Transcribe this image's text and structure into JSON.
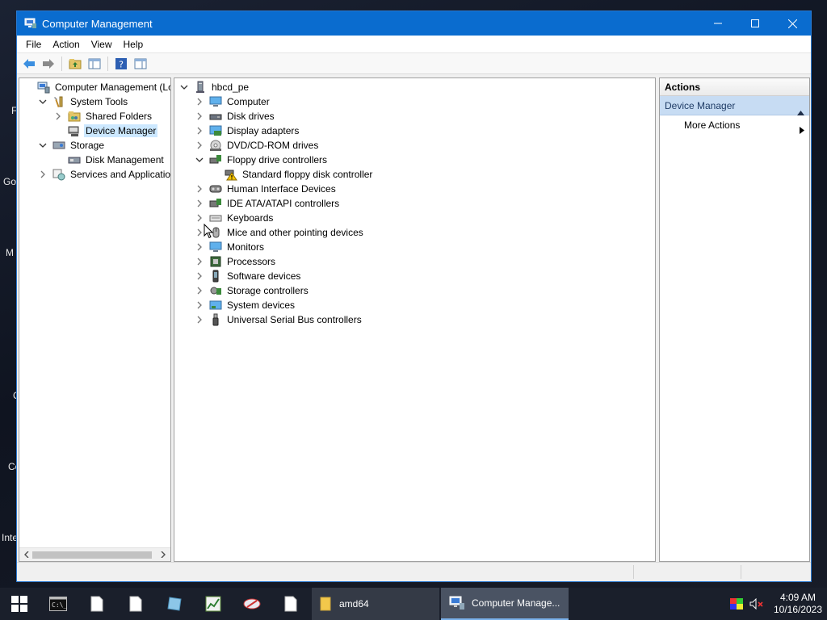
{
  "window": {
    "title": "Computer Management",
    "menus": [
      "File",
      "Action",
      "View",
      "Help"
    ]
  },
  "left_tree": [
    {
      "label": "Computer Management (Local",
      "icon": "computer-management-icon",
      "expand": "none",
      "level": 0
    },
    {
      "label": "System Tools",
      "icon": "tools-icon",
      "expand": "open",
      "level": 1
    },
    {
      "label": "Shared Folders",
      "icon": "shared-folder-icon",
      "expand": "closed",
      "level": 2
    },
    {
      "label": "Device Manager",
      "icon": "device-manager-icon",
      "expand": "none",
      "level": 2,
      "selected": true
    },
    {
      "label": "Storage",
      "icon": "storage-icon",
      "expand": "open",
      "level": 1
    },
    {
      "label": "Disk Management",
      "icon": "disk-management-icon",
      "expand": "none",
      "level": 2
    },
    {
      "label": "Services and Applications",
      "icon": "services-icon",
      "expand": "closed",
      "level": 1
    }
  ],
  "device_tree": [
    {
      "label": "hbcd_pe",
      "icon": "computer-root-icon",
      "expand": "open",
      "level": 0
    },
    {
      "label": "Computer",
      "icon": "monitor-icon",
      "expand": "closed",
      "level": 1
    },
    {
      "label": "Disk drives",
      "icon": "disk-drive-icon",
      "expand": "closed",
      "level": 1
    },
    {
      "label": "Display adapters",
      "icon": "display-adapter-icon",
      "expand": "closed",
      "level": 1
    },
    {
      "label": "DVD/CD-ROM drives",
      "icon": "dvd-icon",
      "expand": "closed",
      "level": 1
    },
    {
      "label": "Floppy drive controllers",
      "icon": "floppy-controller-icon",
      "expand": "open",
      "level": 1
    },
    {
      "label": "Standard floppy disk controller",
      "icon": "warning-device-icon",
      "expand": "none",
      "level": 2
    },
    {
      "label": "Human Interface Devices",
      "icon": "hid-icon",
      "expand": "closed",
      "level": 1
    },
    {
      "label": "IDE ATA/ATAPI controllers",
      "icon": "ide-controller-icon",
      "expand": "closed",
      "level": 1
    },
    {
      "label": "Keyboards",
      "icon": "keyboard-icon",
      "expand": "closed",
      "level": 1
    },
    {
      "label": "Mice and other pointing devices",
      "icon": "mouse-icon",
      "expand": "closed",
      "level": 1
    },
    {
      "label": "Monitors",
      "icon": "monitor-icon",
      "expand": "closed",
      "level": 1
    },
    {
      "label": "Processors",
      "icon": "processor-icon",
      "expand": "closed",
      "level": 1
    },
    {
      "label": "Software devices",
      "icon": "software-device-icon",
      "expand": "closed",
      "level": 1
    },
    {
      "label": "Storage controllers",
      "icon": "storage-controller-icon",
      "expand": "closed",
      "level": 1
    },
    {
      "label": "System devices",
      "icon": "system-device-icon",
      "expand": "closed",
      "level": 1
    },
    {
      "label": "Universal Serial Bus controllers",
      "icon": "usb-icon",
      "expand": "closed",
      "level": 1
    }
  ],
  "actions": {
    "header": "Actions",
    "section": "Device Manager",
    "item": "More Actions"
  },
  "taskbar": {
    "folder_label": "amd64",
    "app_label": "Computer Manage...",
    "time": "4:09 AM",
    "date": "10/16/2023"
  },
  "desktop_labels": [
    "F",
    "Go",
    "M",
    "C",
    "Co",
    "Inte"
  ],
  "colors": {
    "titlebar": "#0a6ccf",
    "selection": "#cce8ff",
    "actions_section": "#c7dcf3"
  }
}
